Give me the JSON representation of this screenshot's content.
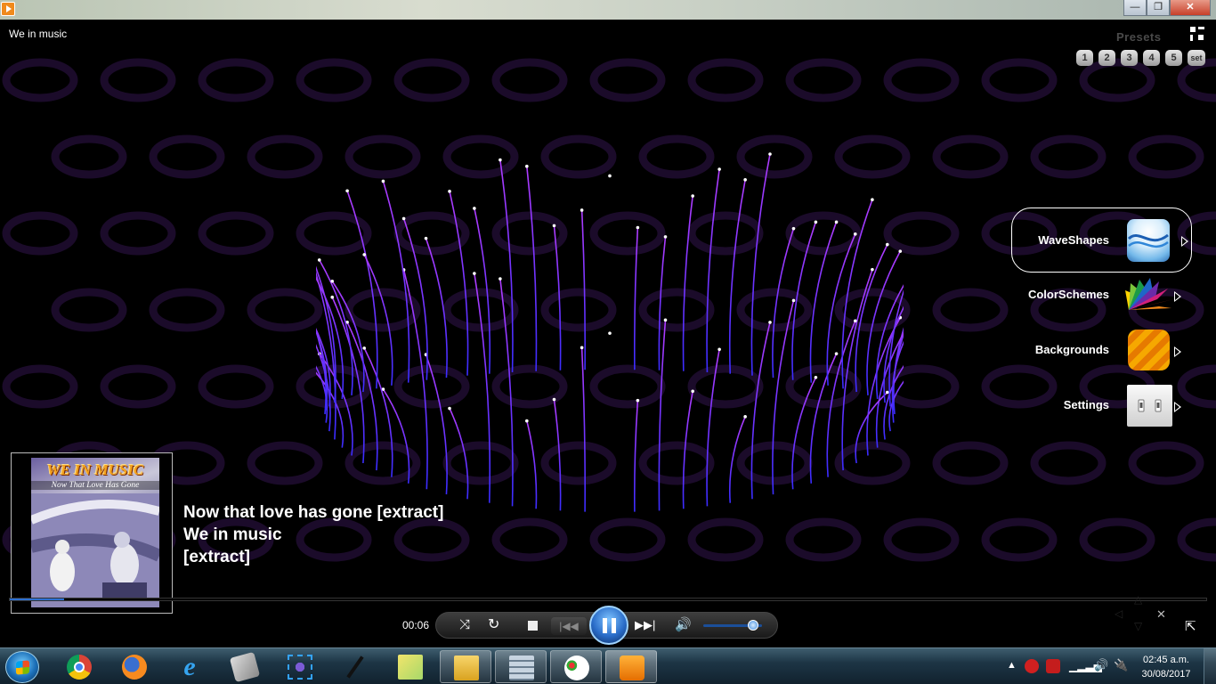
{
  "window": {
    "song_title": "We in music",
    "minimize_label": "—",
    "maximize_label": "❐",
    "close_label": "✕"
  },
  "presets": {
    "label": "Presets",
    "buttons": [
      "1",
      "2",
      "3",
      "4",
      "5",
      "set"
    ]
  },
  "side_menu": {
    "items": [
      {
        "label": "WaveShapes",
        "icon": "waveshape-icon",
        "active": true
      },
      {
        "label": "ColorSchemes",
        "icon": "color-fan-icon",
        "active": false
      },
      {
        "label": "Backgrounds",
        "icon": "background-swatch-icon",
        "active": false
      },
      {
        "label": "Settings",
        "icon": "switches-icon",
        "active": false
      }
    ]
  },
  "album": {
    "title": "WE IN MUSIC",
    "subtitle": "Now That Love Has Gone"
  },
  "now_playing": {
    "track": "Now that love has gone [extract]",
    "artist": "We in music",
    "album": "[extract]"
  },
  "player": {
    "elapsed": "00:06",
    "seek_fraction": 0.045,
    "volume_fraction": 0.85
  },
  "taskbar": {
    "items": [
      "chrome-icon",
      "firefox-icon",
      "internet-explorer-icon",
      "box-app-icon",
      "screen-capture-icon",
      "pen-icon",
      "sticky-notes-icon",
      "file-explorer-icon",
      "calculator-icon",
      "paint-icon",
      "media-player-icon"
    ],
    "clock_time": "02:45 a.m.",
    "clock_date": "30/08/2017"
  },
  "colors": {
    "visualizer_top": "#b03cff",
    "visualizer_bottom": "#3a2cff",
    "accent_blue": "#2c6fd0",
    "pattern_purple": "#1b0b2a"
  }
}
